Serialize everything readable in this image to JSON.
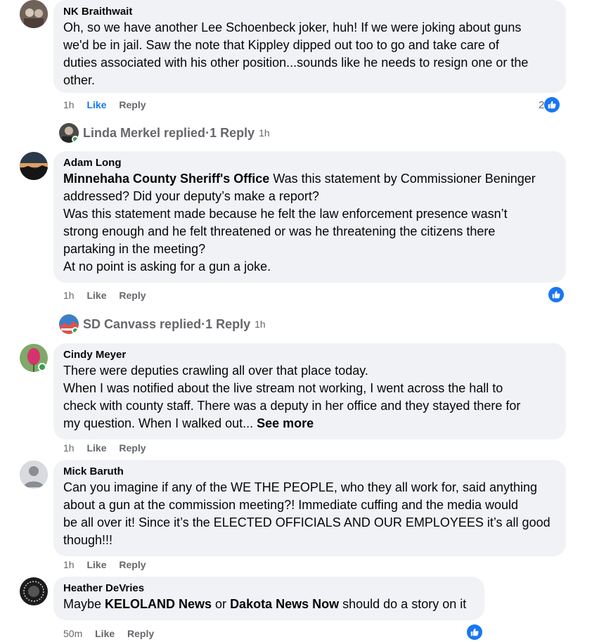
{
  "comments": [
    {
      "author": "NK Braithwait",
      "lines": [
        "Oh, so we have another Lee Schoenbeck joker, huh! If we were joking about guns",
        "we'd be in jail. Saw the note that Kippley dipped out too to go and take care of",
        "duties associated with his other position...sounds like he needs to resign one or the",
        "other."
      ],
      "time": "1h",
      "like": "Like",
      "reply": "Reply",
      "reaction_count": "2"
    },
    {
      "author": "Adam Long",
      "mention": "Minnehaha County Sheriff's Office",
      "lines": [
        " Was this statement by Commissioner Beninger",
        "addressed? Did your deputy’s make a report?",
        "Was this statement made because he felt the law enforcement presence wasn’t",
        "strong enough and he felt threatened or was he threatening the citizens there",
        "partaking in the meeting?",
        "At no point is asking for a gun a joke."
      ],
      "time": "1h",
      "like": "Like",
      "reply": "Reply"
    },
    {
      "author": "Cindy Meyer",
      "lines": [
        "There were deputies crawling all over that place today.",
        "When I was notified about the live stream not working, I went across the hall to",
        "check with county staff. There was a deputy in her office and they stayed there for",
        "my question. When I walked out... "
      ],
      "see_more": "See more",
      "time": "1h",
      "like": "Like",
      "reply": "Reply"
    },
    {
      "author": "Mick Baruth",
      "lines": [
        "Can you imagine if any of the WE THE PEOPLE, who they all work for, said anything",
        "about a gun at the commission meeting?! Immediate cuffing and the media would",
        "be all over it! Since it’s the ELECTED OFFICIALS AND OUR EMPLOYEES it’s all good",
        "though!!!"
      ],
      "time": "1h",
      "like": "Like",
      "reply": "Reply"
    },
    {
      "author": "Heather DeVries",
      "pre": "Maybe ",
      "mention1": "KELOLAND News",
      "mid": " or ",
      "mention2": "Dakota News Now",
      "post": " should do a story on it",
      "time": "50m",
      "like": "Like",
      "reply": "Reply"
    }
  ],
  "reply_threads": [
    {
      "who": "Linda Merkel replied",
      "sep": " · ",
      "count": "1 Reply",
      "ago": "1h"
    },
    {
      "who": "SD Canvass replied",
      "sep": " · ",
      "count": "1 Reply",
      "ago": "1h"
    }
  ],
  "colors": {
    "bubble": "#f0f2f5",
    "secondary_text": "#65676b",
    "link_blue": "#1877f2",
    "online": "#31a24c"
  },
  "icons": {
    "reaction": "thumbs-up-icon"
  }
}
